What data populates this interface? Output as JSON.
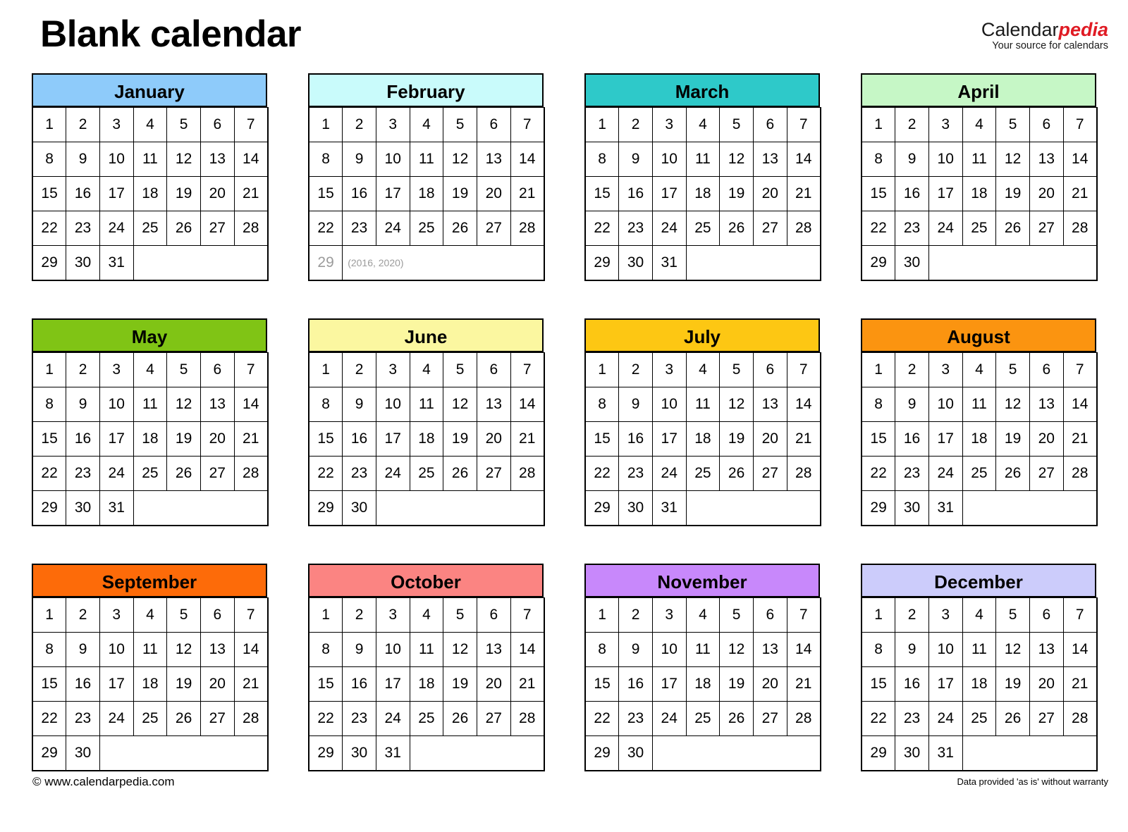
{
  "header": {
    "title": "Blank calendar",
    "brand_primary": "Calendar",
    "brand_secondary": "pedia",
    "brand_tagline": "Your source for calendars"
  },
  "footer": {
    "copyright": "© www.calendarpedia.com",
    "disclaimer": "Data provided 'as is' without warranty"
  },
  "calendar": {
    "columns": 7,
    "months": [
      {
        "name": "January",
        "header_color": "#8ecbfa",
        "days": 31,
        "rows": [
          [
            "1",
            "2",
            "3",
            "4",
            "5",
            "6",
            "7"
          ],
          [
            "8",
            "9",
            "10",
            "11",
            "12",
            "13",
            "14"
          ],
          [
            "15",
            "16",
            "17",
            "18",
            "19",
            "20",
            "21"
          ],
          [
            "22",
            "23",
            "24",
            "25",
            "26",
            "27",
            "28"
          ],
          [
            "29",
            "30",
            "31",
            "",
            "",
            "",
            ""
          ]
        ]
      },
      {
        "name": "February",
        "header_color": "#c9fbfb",
        "days": 28,
        "leap_day": "29",
        "leap_note": "(2016, 2020)",
        "rows": [
          [
            "1",
            "2",
            "3",
            "4",
            "5",
            "6",
            "7"
          ],
          [
            "8",
            "9",
            "10",
            "11",
            "12",
            "13",
            "14"
          ],
          [
            "15",
            "16",
            "17",
            "18",
            "19",
            "20",
            "21"
          ],
          [
            "22",
            "23",
            "24",
            "25",
            "26",
            "27",
            "28"
          ],
          [
            "29",
            "(2016, 2020)",
            "",
            "",
            "",
            "",
            ""
          ]
        ]
      },
      {
        "name": "March",
        "header_color": "#2ec9c9",
        "days": 31,
        "rows": [
          [
            "1",
            "2",
            "3",
            "4",
            "5",
            "6",
            "7"
          ],
          [
            "8",
            "9",
            "10",
            "11",
            "12",
            "13",
            "14"
          ],
          [
            "15",
            "16",
            "17",
            "18",
            "19",
            "20",
            "21"
          ],
          [
            "22",
            "23",
            "24",
            "25",
            "26",
            "27",
            "28"
          ],
          [
            "29",
            "30",
            "31",
            "",
            "",
            "",
            ""
          ]
        ]
      },
      {
        "name": "April",
        "header_color": "#c6f7c6",
        "days": 30,
        "rows": [
          [
            "1",
            "2",
            "3",
            "4",
            "5",
            "6",
            "7"
          ],
          [
            "8",
            "9",
            "10",
            "11",
            "12",
            "13",
            "14"
          ],
          [
            "15",
            "16",
            "17",
            "18",
            "19",
            "20",
            "21"
          ],
          [
            "22",
            "23",
            "24",
            "25",
            "26",
            "27",
            "28"
          ],
          [
            "29",
            "30",
            "",
            "",
            "",
            "",
            ""
          ]
        ]
      },
      {
        "name": "May",
        "header_color": "#80c415",
        "days": 31,
        "rows": [
          [
            "1",
            "2",
            "3",
            "4",
            "5",
            "6",
            "7"
          ],
          [
            "8",
            "9",
            "10",
            "11",
            "12",
            "13",
            "14"
          ],
          [
            "15",
            "16",
            "17",
            "18",
            "19",
            "20",
            "21"
          ],
          [
            "22",
            "23",
            "24",
            "25",
            "26",
            "27",
            "28"
          ],
          [
            "29",
            "30",
            "31",
            "",
            "",
            "",
            ""
          ]
        ]
      },
      {
        "name": "June",
        "header_color": "#fbf7a0",
        "days": 30,
        "rows": [
          [
            "1",
            "2",
            "3",
            "4",
            "5",
            "6",
            "7"
          ],
          [
            "8",
            "9",
            "10",
            "11",
            "12",
            "13",
            "14"
          ],
          [
            "15",
            "16",
            "17",
            "18",
            "19",
            "20",
            "21"
          ],
          [
            "22",
            "23",
            "24",
            "25",
            "26",
            "27",
            "28"
          ],
          [
            "29",
            "30",
            "",
            "",
            "",
            "",
            ""
          ]
        ]
      },
      {
        "name": "July",
        "header_color": "#fdc713",
        "days": 31,
        "rows": [
          [
            "1",
            "2",
            "3",
            "4",
            "5",
            "6",
            "7"
          ],
          [
            "8",
            "9",
            "10",
            "11",
            "12",
            "13",
            "14"
          ],
          [
            "15",
            "16",
            "17",
            "18",
            "19",
            "20",
            "21"
          ],
          [
            "22",
            "23",
            "24",
            "25",
            "26",
            "27",
            "28"
          ],
          [
            "29",
            "30",
            "31",
            "",
            "",
            "",
            ""
          ]
        ]
      },
      {
        "name": "August",
        "header_color": "#fb9410",
        "days": 31,
        "rows": [
          [
            "1",
            "2",
            "3",
            "4",
            "5",
            "6",
            "7"
          ],
          [
            "8",
            "9",
            "10",
            "11",
            "12",
            "13",
            "14"
          ],
          [
            "15",
            "16",
            "17",
            "18",
            "19",
            "20",
            "21"
          ],
          [
            "22",
            "23",
            "24",
            "25",
            "26",
            "27",
            "28"
          ],
          [
            "29",
            "30",
            "31",
            "",
            "",
            "",
            ""
          ]
        ]
      },
      {
        "name": "September",
        "header_color": "#fd6b09",
        "days": 30,
        "rows": [
          [
            "1",
            "2",
            "3",
            "4",
            "5",
            "6",
            "7"
          ],
          [
            "8",
            "9",
            "10",
            "11",
            "12",
            "13",
            "14"
          ],
          [
            "15",
            "16",
            "17",
            "18",
            "19",
            "20",
            "21"
          ],
          [
            "22",
            "23",
            "24",
            "25",
            "26",
            "27",
            "28"
          ],
          [
            "29",
            "30",
            "",
            "",
            "",
            "",
            ""
          ]
        ]
      },
      {
        "name": "October",
        "header_color": "#fb8482",
        "days": 31,
        "rows": [
          [
            "1",
            "2",
            "3",
            "4",
            "5",
            "6",
            "7"
          ],
          [
            "8",
            "9",
            "10",
            "11",
            "12",
            "13",
            "14"
          ],
          [
            "15",
            "16",
            "17",
            "18",
            "19",
            "20",
            "21"
          ],
          [
            "22",
            "23",
            "24",
            "25",
            "26",
            "27",
            "28"
          ],
          [
            "29",
            "30",
            "31",
            "",
            "",
            "",
            ""
          ]
        ]
      },
      {
        "name": "November",
        "header_color": "#c888fb",
        "days": 30,
        "rows": [
          [
            "1",
            "2",
            "3",
            "4",
            "5",
            "6",
            "7"
          ],
          [
            "8",
            "9",
            "10",
            "11",
            "12",
            "13",
            "14"
          ],
          [
            "15",
            "16",
            "17",
            "18",
            "19",
            "20",
            "21"
          ],
          [
            "22",
            "23",
            "24",
            "25",
            "26",
            "27",
            "28"
          ],
          [
            "29",
            "30",
            "",
            "",
            "",
            "",
            ""
          ]
        ]
      },
      {
        "name": "December",
        "header_color": "#ccccfb",
        "days": 31,
        "rows": [
          [
            "1",
            "2",
            "3",
            "4",
            "5",
            "6",
            "7"
          ],
          [
            "8",
            "9",
            "10",
            "11",
            "12",
            "13",
            "14"
          ],
          [
            "15",
            "16",
            "17",
            "18",
            "19",
            "20",
            "21"
          ],
          [
            "22",
            "23",
            "24",
            "25",
            "26",
            "27",
            "28"
          ],
          [
            "29",
            "30",
            "31",
            "",
            "",
            "",
            ""
          ]
        ]
      }
    ]
  }
}
